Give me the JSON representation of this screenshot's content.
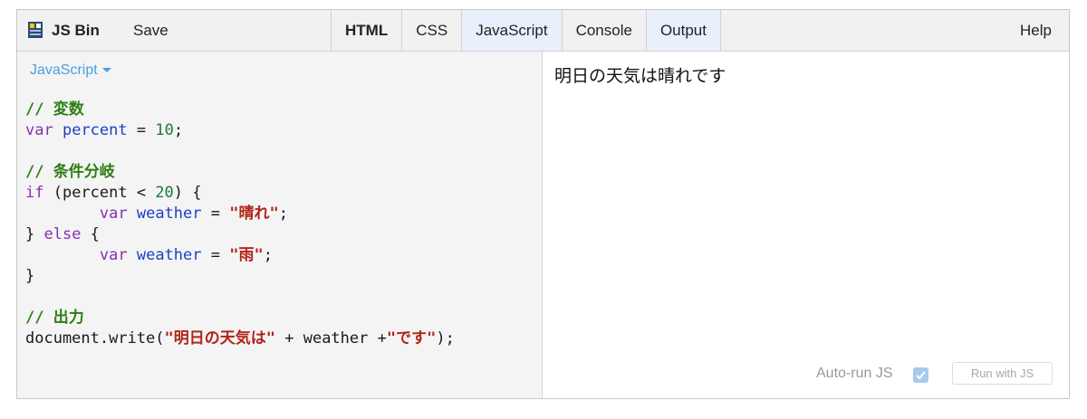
{
  "app": {
    "name": "JS Bin"
  },
  "toolbar": {
    "save_label": "Save",
    "help_label": "Help",
    "tabs": [
      {
        "label": "HTML",
        "bold": true,
        "active": false
      },
      {
        "label": "CSS",
        "bold": false,
        "active": false
      },
      {
        "label": "JavaScript",
        "bold": false,
        "active": true
      },
      {
        "label": "Console",
        "bold": false,
        "active": false
      },
      {
        "label": "Output",
        "bold": false,
        "active": true
      }
    ]
  },
  "editor": {
    "language_label": "JavaScript",
    "code_lines": [
      [
        {
          "t": "// 変数",
          "c": "comment"
        }
      ],
      [
        {
          "t": "var",
          "c": "kw"
        },
        {
          "t": " ",
          "c": "plain"
        },
        {
          "t": "percent",
          "c": "var"
        },
        {
          "t": " = ",
          "c": "plain"
        },
        {
          "t": "10",
          "c": "num"
        },
        {
          "t": ";",
          "c": "plain"
        }
      ],
      [],
      [
        {
          "t": "// 条件分岐",
          "c": "comment"
        }
      ],
      [
        {
          "t": "if",
          "c": "kw"
        },
        {
          "t": " (percent < ",
          "c": "plain"
        },
        {
          "t": "20",
          "c": "num"
        },
        {
          "t": ") {",
          "c": "plain"
        }
      ],
      [
        {
          "t": "        ",
          "c": "plain"
        },
        {
          "t": "var",
          "c": "kw"
        },
        {
          "t": " ",
          "c": "plain"
        },
        {
          "t": "weather",
          "c": "var"
        },
        {
          "t": " = ",
          "c": "plain"
        },
        {
          "t": "\"晴れ\"",
          "c": "str"
        },
        {
          "t": ";",
          "c": "plain"
        }
      ],
      [
        {
          "t": "} ",
          "c": "plain"
        },
        {
          "t": "else",
          "c": "kw"
        },
        {
          "t": " {",
          "c": "plain"
        }
      ],
      [
        {
          "t": "        ",
          "c": "plain"
        },
        {
          "t": "var",
          "c": "kw"
        },
        {
          "t": " ",
          "c": "plain"
        },
        {
          "t": "weather",
          "c": "var"
        },
        {
          "t": " = ",
          "c": "plain"
        },
        {
          "t": "\"雨\"",
          "c": "str"
        },
        {
          "t": ";",
          "c": "plain"
        }
      ],
      [
        {
          "t": "}",
          "c": "plain"
        }
      ],
      [],
      [
        {
          "t": "// 出力",
          "c": "comment"
        }
      ],
      [
        {
          "t": "document.write(",
          "c": "plain"
        },
        {
          "t": "\"明日の天気は\"",
          "c": "str"
        },
        {
          "t": " + weather +",
          "c": "plain"
        },
        {
          "t": "\"です\"",
          "c": "str"
        },
        {
          "t": ");",
          "c": "plain"
        }
      ]
    ]
  },
  "output": {
    "text": "明日の天気は晴れです",
    "autorun_label": "Auto-run JS",
    "autorun_checked": true,
    "run_button_label": "Run with JS"
  },
  "colors": {
    "active_tab_bg": "#e9f0fb",
    "language_link": "#4a9ee0",
    "comment": "#2e7d14",
    "keyword": "#8a2fb0",
    "variable": "#1b3ec7",
    "number": "#1b7a3f",
    "string": "#b22519"
  },
  "icons": {
    "logo": "jsbin-logo-icon",
    "caret": "chevron-down-icon",
    "check": "checkmark-icon"
  }
}
